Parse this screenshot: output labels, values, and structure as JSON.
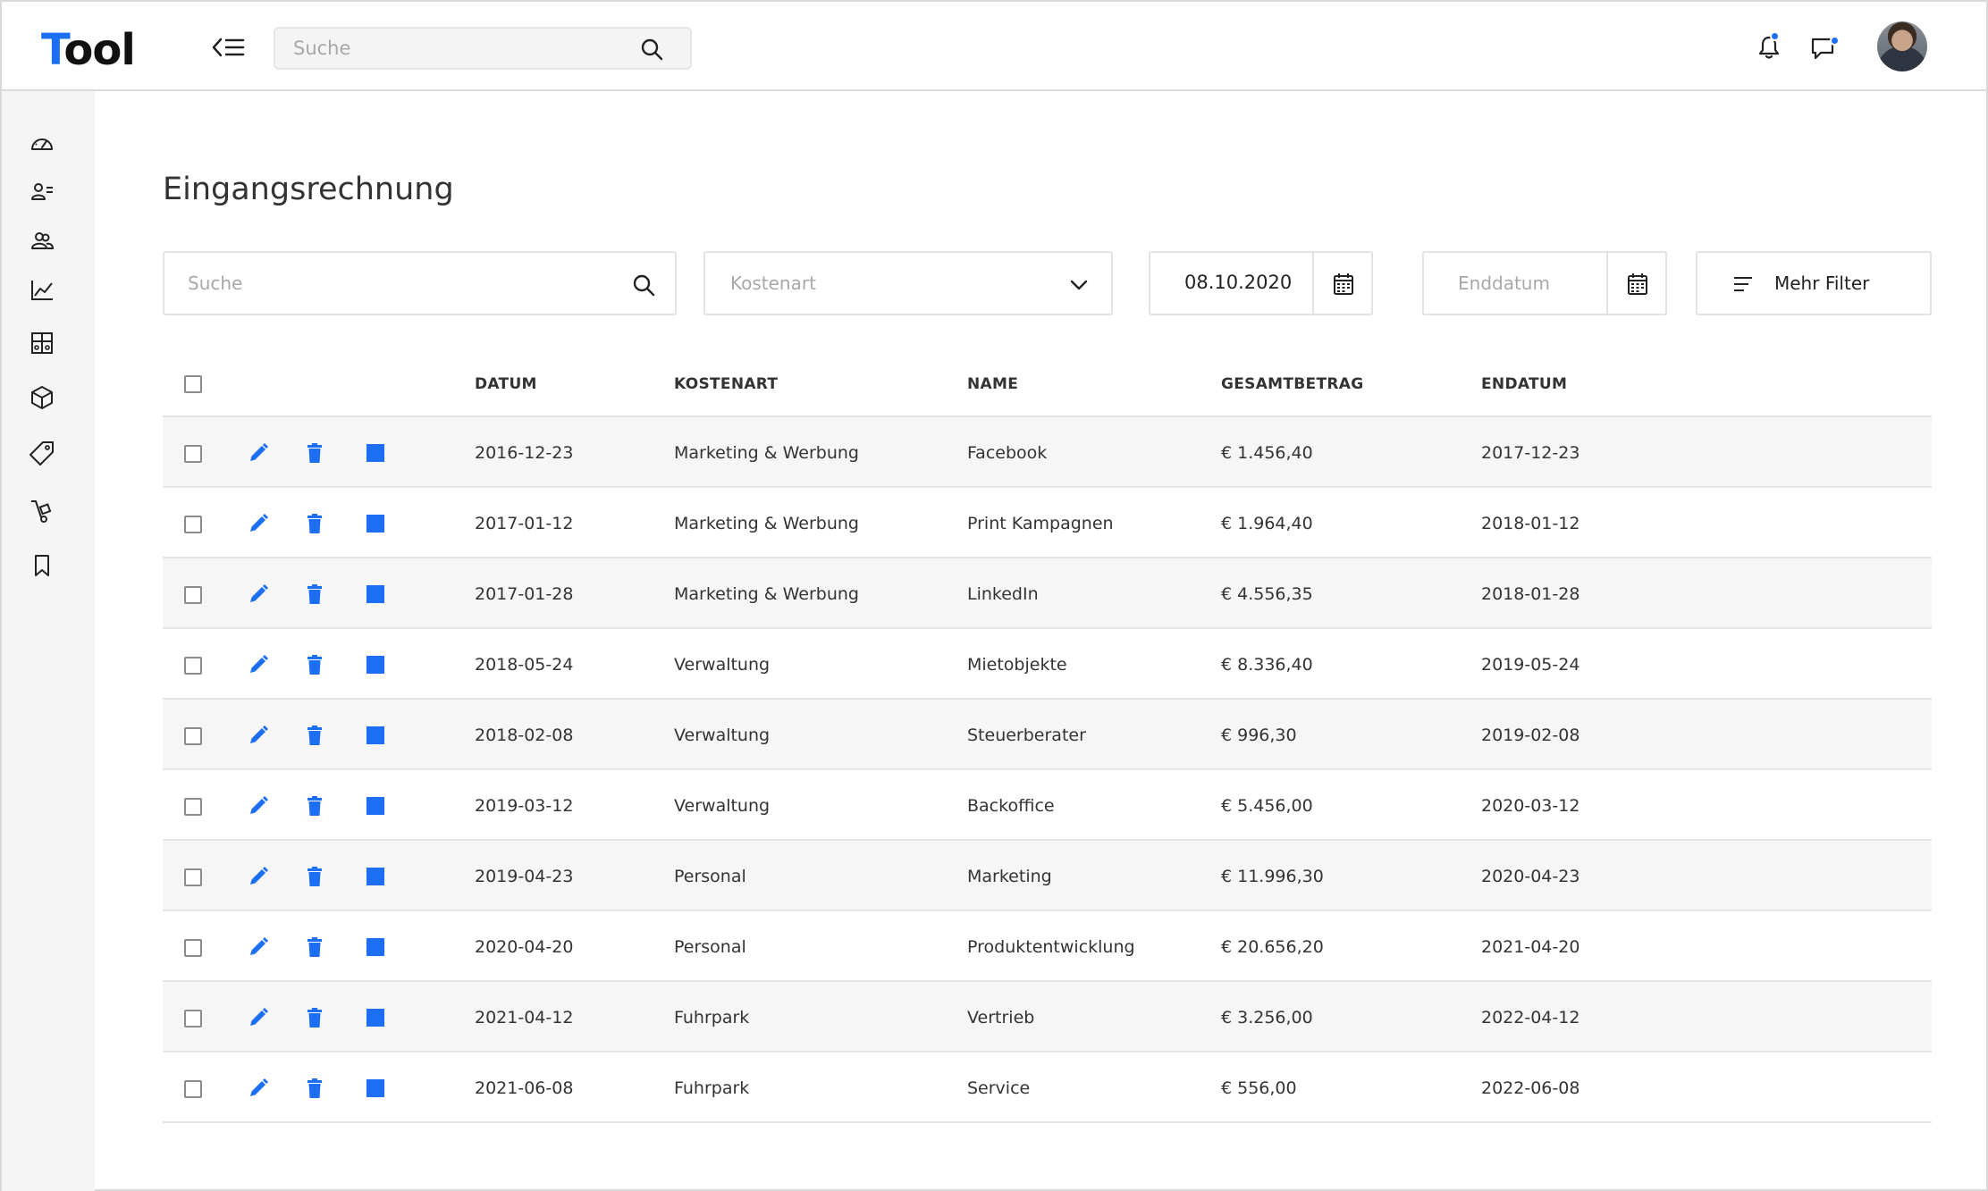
{
  "app": {
    "logo_first": "T",
    "logo_rest": "ool",
    "accent_color": "#1c6ef2"
  },
  "topbar": {
    "search_placeholder": "Suche",
    "notification_icon": "bell-icon",
    "messages_icon": "chat-icon"
  },
  "sidebar": {
    "items": [
      {
        "icon": "dashboard-gauge-icon"
      },
      {
        "icon": "contacts-list-icon"
      },
      {
        "icon": "users-group-icon"
      },
      {
        "icon": "chart-line-icon"
      },
      {
        "icon": "layout-grid-icon"
      },
      {
        "icon": "package-box-icon"
      },
      {
        "icon": "price-tag-icon"
      },
      {
        "icon": "hand-truck-icon"
      },
      {
        "icon": "bookmark-icon"
      }
    ]
  },
  "page": {
    "title": "Eingangsrechnung"
  },
  "filters": {
    "search_placeholder": "Suche",
    "kostenart_placeholder": "Kostenart",
    "start_date": "08.10.2020",
    "end_date_placeholder": "Enddatum",
    "more_filters": "Mehr Filter"
  },
  "table": {
    "columns": [
      "DATUM",
      "KOSTENART",
      "NAME",
      "GESAMTBETRAG",
      "ENDATUM"
    ],
    "rows": [
      {
        "datum": "2016-12-23",
        "kostenart": "Marketing & Werbung",
        "name": "Facebook",
        "betrag": "€ 1.456,40",
        "enddatum": "2017-12-23"
      },
      {
        "datum": "2017-01-12",
        "kostenart": "Marketing & Werbung",
        "name": "Print Kampagnen",
        "betrag": "€ 1.964,40",
        "enddatum": "2018-01-12"
      },
      {
        "datum": "2017-01-28",
        "kostenart": "Marketing & Werbung",
        "name": "LinkedIn",
        "betrag": "€ 4.556,35",
        "enddatum": "2018-01-28"
      },
      {
        "datum": "2018-05-24",
        "kostenart": "Verwaltung",
        "name": "Mietobjekte",
        "betrag": "€ 8.336,40",
        "enddatum": "2019-05-24"
      },
      {
        "datum": "2018-02-08",
        "kostenart": "Verwaltung",
        "name": "Steuerberater",
        "betrag": "€ 996,30",
        "enddatum": "2019-02-08"
      },
      {
        "datum": "2019-03-12",
        "kostenart": "Verwaltung",
        "name": "Backoffice",
        "betrag": "€ 5.456,00",
        "enddatum": "2020-03-12"
      },
      {
        "datum": "2019-04-23",
        "kostenart": "Personal",
        "name": "Marketing",
        "betrag": "€ 11.996,30",
        "enddatum": "2020-04-23"
      },
      {
        "datum": "2020-04-20",
        "kostenart": "Personal",
        "name": "Produktentwicklung",
        "betrag": "€ 20.656,20",
        "enddatum": "2021-04-20"
      },
      {
        "datum": "2021-04-12",
        "kostenart": "Fuhrpark",
        "name": "Vertrieb",
        "betrag": "€ 3.256,00",
        "enddatum": "2022-04-12"
      },
      {
        "datum": "2021-06-08",
        "kostenart": "Fuhrpark",
        "name": "Service",
        "betrag": "€ 556,00",
        "enddatum": "2022-06-08"
      }
    ],
    "row_action_icons": [
      "pencil-edit-icon",
      "trash-delete-icon",
      "document-square-icon"
    ]
  }
}
